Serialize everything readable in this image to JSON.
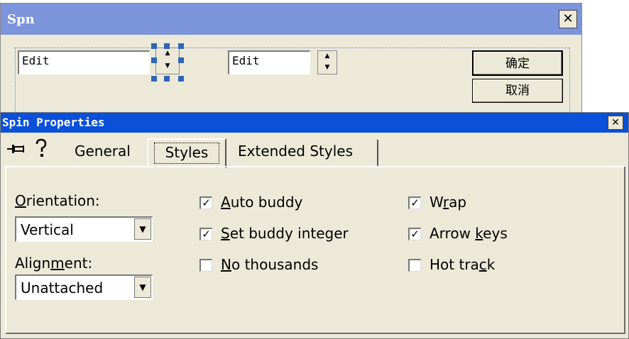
{
  "dialog": {
    "title": "Spn",
    "close_glyph": "✕",
    "edit1_value": "Edit",
    "edit2_value": "Edit",
    "ok_label": "确定",
    "cancel_label": "取消"
  },
  "props": {
    "title": "Spin Properties",
    "close_glyph": "✕",
    "tabs": [
      {
        "label": "General"
      },
      {
        "label": "Styles"
      },
      {
        "label": "Extended Styles"
      }
    ],
    "orientation": {
      "label_pre": "",
      "label_u": "O",
      "label_post": "rientation:",
      "value": "Vertical"
    },
    "alignment": {
      "label_pre": "Align",
      "label_u": "m",
      "label_post": "ent:",
      "value": "Unattached"
    },
    "checkboxes": [
      {
        "pre": "",
        "u": "A",
        "post": "uto buddy",
        "checked": true
      },
      {
        "pre": "",
        "u": "S",
        "post": "et buddy integer",
        "checked": true
      },
      {
        "pre": "",
        "u": "N",
        "post": "o thousands",
        "checked": false
      },
      {
        "pre": "W",
        "u": "r",
        "post": "ap",
        "checked": true
      },
      {
        "pre": "Arrow ",
        "u": "k",
        "post": "eys",
        "checked": true
      },
      {
        "pre": "Hot tra",
        "u": "c",
        "post": "k",
        "checked": false
      }
    ],
    "check_mark": "✓",
    "icons": {
      "pin": "pushpin-icon",
      "help": "help-icon"
    }
  }
}
